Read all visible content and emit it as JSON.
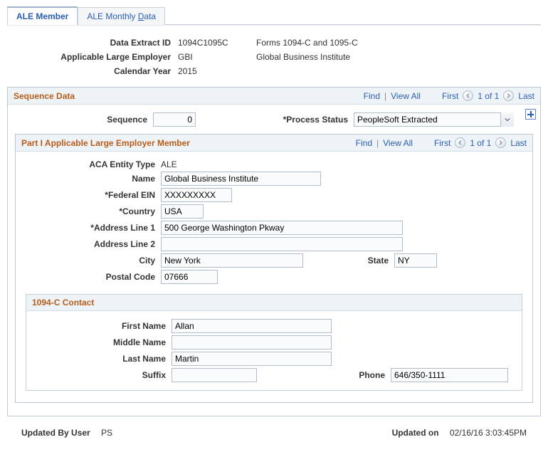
{
  "tabs": {
    "active": "ALE Member",
    "other": "ALE Monthly Data",
    "other_pre": "ALE Monthly ",
    "other_key": "D",
    "other_post": "ata"
  },
  "header": {
    "extract_id_label": "Data Extract ID",
    "extract_id": "1094C1095C",
    "extract_desc": "Forms 1094-C and 1095-C",
    "employer_label": "Applicable Large Employer",
    "employer_id": "GBI",
    "employer_desc": "Global Business Institute",
    "year_label": "Calendar Year",
    "year": "2015"
  },
  "seq_group": {
    "title": "Sequence Data",
    "find": "Find",
    "view_all": "View All",
    "first": "First",
    "nav": "1 of 1",
    "last": "Last",
    "sequence_label": "Sequence",
    "sequence": "0",
    "process_status_label": "*Process Status",
    "process_status": "PeopleSoft Extracted"
  },
  "part1": {
    "title": "Part I Applicable Large Employer Member",
    "find": "Find",
    "view_all": "View All",
    "first": "First",
    "nav": "1 of 1",
    "last": "Last",
    "entity_type_label": "ACA Entity Type",
    "entity_type": "ALE",
    "name_label": "Name",
    "name": "Global Business Institute",
    "fein_label": "*Federal EIN",
    "fein": "XXXXXXXXX",
    "country_label": "*Country",
    "country": "USA",
    "addr1_label": "*Address Line 1",
    "addr1": "500 George Washington Pkway",
    "addr2_label": "Address Line 2",
    "addr2": "",
    "city_label": "City",
    "city": "New York",
    "state_label": "State",
    "state": "NY",
    "postal_label": "Postal Code",
    "postal": "07666"
  },
  "contact": {
    "title": "1094-C Contact",
    "first_name_label": "First Name",
    "first_name": "Allan",
    "middle_name_label": "Middle Name",
    "middle_name": "",
    "last_name_label": "Last Name",
    "last_name": "Martin",
    "suffix_label": "Suffix",
    "suffix": "",
    "phone_label": "Phone",
    "phone": "646/350-1111"
  },
  "footer": {
    "updated_by_label": "Updated By User",
    "updated_by": "PS",
    "updated_on_label": "Updated on",
    "updated_on": "02/16/16  3:03:45PM"
  }
}
